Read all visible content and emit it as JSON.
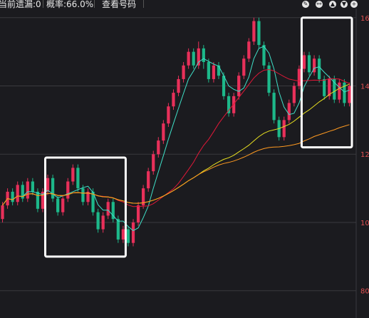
{
  "header": {
    "current_label": "当前遗漏:0",
    "probability_label": "概率:66.0%",
    "view_code_button": "查看号码"
  },
  "toolbar": {
    "icons": [
      "pencil-icon",
      "link-icon",
      "arrow-up-icon",
      "arrow-down-icon",
      "plus-icon"
    ]
  },
  "colors": {
    "background": "#1b1b1f",
    "grid": "#3a3a3f",
    "up_candle": "#e8305a",
    "down_candle": "#1db88a",
    "ma_fast": "#3fe0c8",
    "ma_mid": "#e01838",
    "ma_slow": "#e8e020",
    "ma_long": "#ff9a20",
    "axis_text": "#e05050",
    "highlight_box": "#ffffff"
  },
  "chart_data": {
    "type": "candlestick",
    "y_ticks": [
      "16",
      "14",
      "12",
      "10",
      "80"
    ],
    "y_tick_values": [
      16,
      14,
      12,
      10,
      8
    ],
    "ylim": [
      7.2,
      16.1
    ],
    "x_count": 70,
    "candles": [
      [
        10.1,
        10.5,
        10.0,
        10.6
      ],
      [
        10.5,
        10.9,
        10.4,
        11.0
      ],
      [
        10.9,
        10.6,
        10.5,
        11.0
      ],
      [
        10.6,
        11.1,
        10.5,
        11.2
      ],
      [
        11.1,
        10.7,
        10.6,
        11.2
      ],
      [
        10.7,
        11.2,
        10.6,
        11.3
      ],
      [
        11.2,
        10.9,
        10.8,
        11.3
      ],
      [
        10.9,
        10.4,
        10.3,
        11.0
      ],
      [
        10.4,
        10.9,
        10.3,
        11.0
      ],
      [
        10.9,
        11.3,
        10.8,
        11.4
      ],
      [
        11.3,
        10.7,
        10.6,
        11.4
      ],
      [
        10.7,
        10.3,
        10.2,
        10.8
      ],
      [
        10.3,
        10.7,
        10.2,
        10.8
      ],
      [
        10.7,
        11.2,
        10.6,
        11.3
      ],
      [
        11.2,
        11.6,
        11.1,
        11.7
      ],
      [
        11.6,
        11.0,
        10.9,
        11.7
      ],
      [
        11.0,
        10.6,
        10.5,
        11.1
      ],
      [
        10.6,
        10.9,
        10.5,
        11.0
      ],
      [
        10.9,
        10.3,
        10.2,
        11.0
      ],
      [
        10.3,
        9.8,
        9.7,
        10.4
      ],
      [
        9.8,
        10.2,
        9.7,
        10.3
      ],
      [
        10.2,
        10.6,
        10.1,
        10.7
      ],
      [
        10.6,
        10.1,
        10.0,
        10.7
      ],
      [
        10.1,
        9.5,
        9.4,
        10.2
      ],
      [
        9.5,
        9.8,
        9.4,
        9.9
      ],
      [
        9.8,
        9.4,
        9.3,
        9.9
      ],
      [
        9.4,
        10.0,
        9.3,
        10.1
      ],
      [
        10.0,
        10.5,
        9.9,
        10.6
      ],
      [
        10.5,
        11.0,
        10.4,
        11.1
      ],
      [
        11.0,
        11.5,
        10.9,
        11.6
      ],
      [
        11.5,
        12.0,
        11.4,
        12.1
      ],
      [
        12.0,
        12.4,
        11.9,
        12.5
      ],
      [
        12.4,
        12.9,
        12.3,
        13.0
      ],
      [
        12.9,
        13.4,
        12.8,
        13.5
      ],
      [
        13.4,
        13.8,
        13.3,
        13.9
      ],
      [
        13.8,
        14.2,
        13.7,
        14.3
      ],
      [
        14.2,
        14.6,
        14.1,
        14.7
      ],
      [
        14.6,
        15.0,
        14.5,
        15.1
      ],
      [
        15.0,
        14.6,
        14.5,
        15.1
      ],
      [
        14.6,
        15.1,
        14.5,
        15.3
      ],
      [
        15.1,
        14.7,
        14.5,
        15.2
      ],
      [
        14.7,
        14.2,
        14.1,
        14.8
      ],
      [
        14.2,
        14.6,
        14.1,
        14.7
      ],
      [
        14.6,
        14.3,
        14.2,
        14.7
      ],
      [
        14.3,
        13.7,
        13.6,
        14.4
      ],
      [
        13.7,
        13.2,
        13.1,
        13.8
      ],
      [
        13.2,
        13.7,
        13.1,
        13.8
      ],
      [
        13.7,
        14.3,
        13.6,
        14.4
      ],
      [
        14.3,
        14.8,
        14.2,
        14.9
      ],
      [
        14.8,
        15.3,
        14.7,
        15.4
      ],
      [
        15.3,
        15.9,
        15.2,
        16.0
      ],
      [
        15.9,
        15.2,
        15.1,
        16.0
      ],
      [
        15.2,
        14.6,
        14.5,
        15.3
      ],
      [
        14.6,
        13.8,
        13.7,
        14.7
      ],
      [
        13.8,
        13.0,
        12.9,
        13.9
      ],
      [
        13.0,
        12.5,
        12.4,
        13.1
      ],
      [
        12.5,
        13.0,
        12.4,
        13.1
      ],
      [
        13.0,
        13.5,
        12.9,
        13.6
      ],
      [
        13.5,
        14.0,
        13.4,
        14.1
      ],
      [
        14.0,
        14.5,
        13.9,
        14.6
      ],
      [
        14.5,
        14.9,
        14.4,
        15.0
      ],
      [
        14.9,
        14.4,
        14.3,
        15.0
      ],
      [
        14.4,
        14.8,
        14.3,
        14.9
      ],
      [
        14.8,
        14.2,
        14.1,
        14.9
      ],
      [
        14.2,
        13.7,
        13.6,
        14.3
      ],
      [
        13.7,
        14.2,
        13.6,
        14.3
      ],
      [
        14.2,
        13.6,
        13.5,
        14.3
      ],
      [
        13.6,
        14.1,
        13.5,
        14.2
      ],
      [
        14.1,
        13.5,
        13.4,
        14.2
      ],
      [
        13.5,
        14.0,
        13.4,
        14.1
      ]
    ],
    "candles_note": "",
    "ma_fast": [],
    "highlight_boxes": [
      {
        "from_index": 9,
        "to_index": 24,
        "y_top": 11.9,
        "y_bottom": 9.0
      },
      {
        "from_index": 60,
        "to_index": 69,
        "y_top": 16.0,
        "y_bottom": 12.2
      }
    ]
  }
}
